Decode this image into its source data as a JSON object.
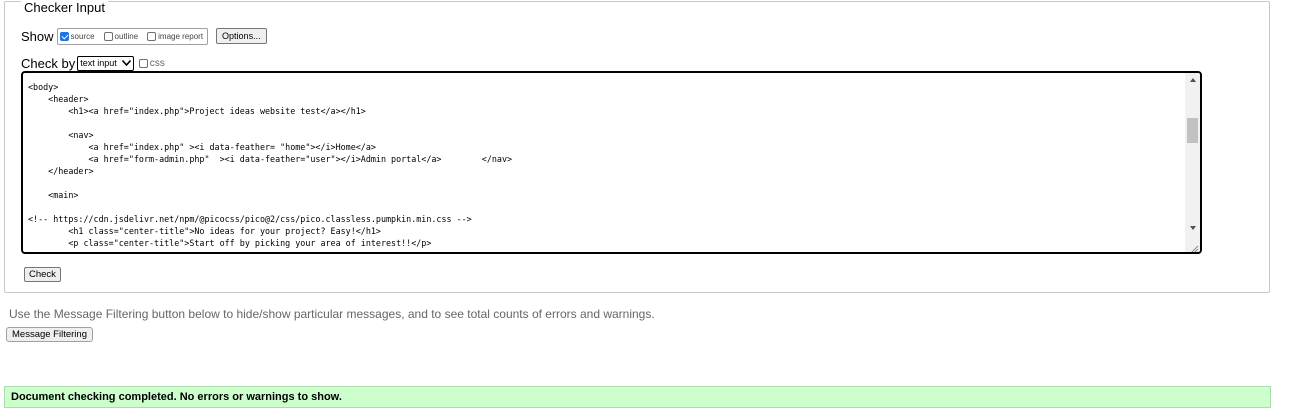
{
  "checker": {
    "legend": "Checker Input",
    "show_label": "Show",
    "show_options": [
      {
        "label": "source",
        "checked": true
      },
      {
        "label": "outline",
        "checked": false
      },
      {
        "label": "image report",
        "checked": false
      }
    ],
    "options_button": "Options...",
    "check_by_label": "Check by",
    "check_by_selected": "text input",
    "css_label": "css",
    "css_checked": false,
    "check_button": "Check"
  },
  "editor": {
    "lines": [
      "<body>",
      "    <header>",
      "        <h1><a href=\"index.php\">Project ideas website test</a></h1>",
      "",
      "        <nav>",
      "            <a href=\"index.php\" ><i data-feather= \"home\"></i>Home</a>",
      "            <a href=\"form-admin.php\"  ><i data-feather=\"user\"></i>Admin portal</a>        </nav>",
      "    </header>",
      "",
      "    <main>",
      "",
      "<!-- https://cdn.jsdelivr.net/npm/@picocss/pico@2/css/pico.classless.pumpkin.min.css -->",
      "        <h1 class=\"center-title\">No ideas for your project? Easy!</h1>",
      "        <p class=\"center-title\">Start off by picking your area of interest!!</p>"
    ]
  },
  "message_filtering": {
    "info": "Use the Message Filtering button below to hide/show particular messages, and to see total counts of errors and warnings.",
    "button": "Message Filtering"
  },
  "status": {
    "message": "Document checking completed. No errors or warnings to show.",
    "color": "#ccffcc"
  }
}
